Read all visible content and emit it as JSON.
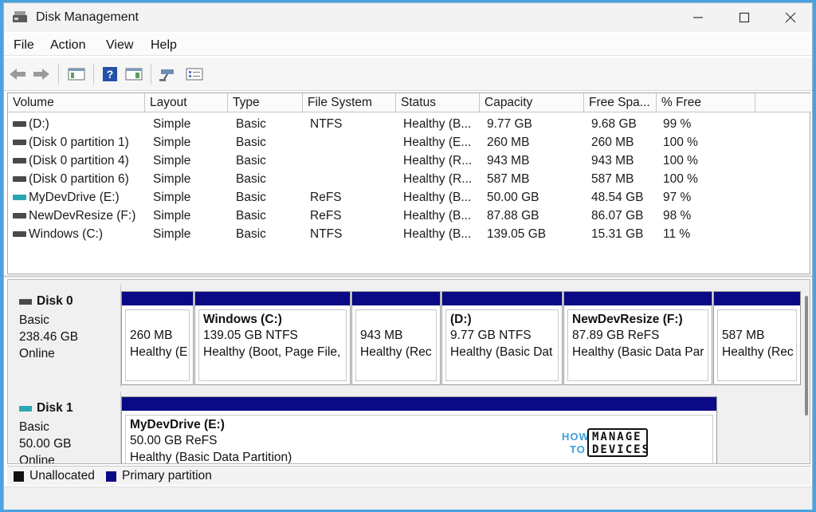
{
  "window": {
    "title": "Disk Management"
  },
  "menu": [
    "File",
    "Action",
    "View",
    "Help"
  ],
  "columns": [
    "Volume",
    "Layout",
    "Type",
    "File System",
    "Status",
    "Capacity",
    "Free Spa...",
    "% Free"
  ],
  "volumes": [
    {
      "volume": " (D:)",
      "layout": "Simple",
      "type": "Basic",
      "fs": "NTFS",
      "status": "Healthy (B...",
      "capacity": "9.77 GB",
      "free": "9.68 GB",
      "pct": "99 %",
      "icon": "drive-icon"
    },
    {
      "volume": "(Disk 0 partition 1)",
      "layout": "Simple",
      "type": "Basic",
      "fs": "",
      "status": "Healthy (E...",
      "capacity": "260 MB",
      "free": "260 MB",
      "pct": "100 %",
      "icon": "drive-icon"
    },
    {
      "volume": "(Disk 0 partition 4)",
      "layout": "Simple",
      "type": "Basic",
      "fs": "",
      "status": "Healthy (R...",
      "capacity": "943 MB",
      "free": "943 MB",
      "pct": "100 %",
      "icon": "drive-icon"
    },
    {
      "volume": "(Disk 0 partition 6)",
      "layout": "Simple",
      "type": "Basic",
      "fs": "",
      "status": "Healthy (R...",
      "capacity": "587 MB",
      "free": "587 MB",
      "pct": "100 %",
      "icon": "drive-icon"
    },
    {
      "volume": "MyDevDrive (E:)",
      "layout": "Simple",
      "type": "Basic",
      "fs": "ReFS",
      "status": "Healthy (B...",
      "capacity": "50.00 GB",
      "free": "48.54 GB",
      "pct": "97 %",
      "icon": "dev-drive-icon"
    },
    {
      "volume": "NewDevResize (F:)",
      "layout": "Simple",
      "type": "Basic",
      "fs": "ReFS",
      "status": "Healthy (B...",
      "capacity": "87.88 GB",
      "free": "86.07 GB",
      "pct": "98 %",
      "icon": "drive-icon"
    },
    {
      "volume": "Windows (C:)",
      "layout": "Simple",
      "type": "Basic",
      "fs": "NTFS",
      "status": "Healthy (B...",
      "capacity": "139.05 GB",
      "free": "15.31 GB",
      "pct": "11 %",
      "icon": "drive-icon"
    }
  ],
  "disks": [
    {
      "name": "Disk 0",
      "type": "Basic",
      "size": "238.46 GB",
      "status": "Online",
      "partitions": [
        {
          "title": "",
          "line1": "260 MB",
          "line2": "Healthy (E"
        },
        {
          "title": "Windows  (C:)",
          "line1": "139.05 GB NTFS",
          "line2": "Healthy (Boot, Page File,"
        },
        {
          "title": "",
          "line1": "943 MB",
          "line2": "Healthy (Rec"
        },
        {
          "title": " (D:)",
          "line1": "9.77 GB NTFS",
          "line2": "Healthy (Basic Dat"
        },
        {
          "title": "NewDevResize  (F:)",
          "line1": "87.89 GB ReFS",
          "line2": "Healthy (Basic Data Par"
        },
        {
          "title": "",
          "line1": "587 MB",
          "line2": "Healthy (Rec"
        }
      ]
    },
    {
      "name": "Disk 1",
      "type": "Basic",
      "size": "50.00 GB",
      "status": "Online",
      "partitions": [
        {
          "title": "MyDevDrive  (E:)",
          "line1": "50.00 GB ReFS",
          "line2": "Healthy (Basic Data Partition)"
        }
      ]
    }
  ],
  "legend": [
    {
      "label": "Unallocated",
      "color": "#111111"
    },
    {
      "label": "Primary partition",
      "color": "#0a0a86"
    }
  ],
  "watermark": {
    "how": "HOW",
    "to": "TO",
    "line1": "MANAGE",
    "line2": "DEVICES"
  }
}
